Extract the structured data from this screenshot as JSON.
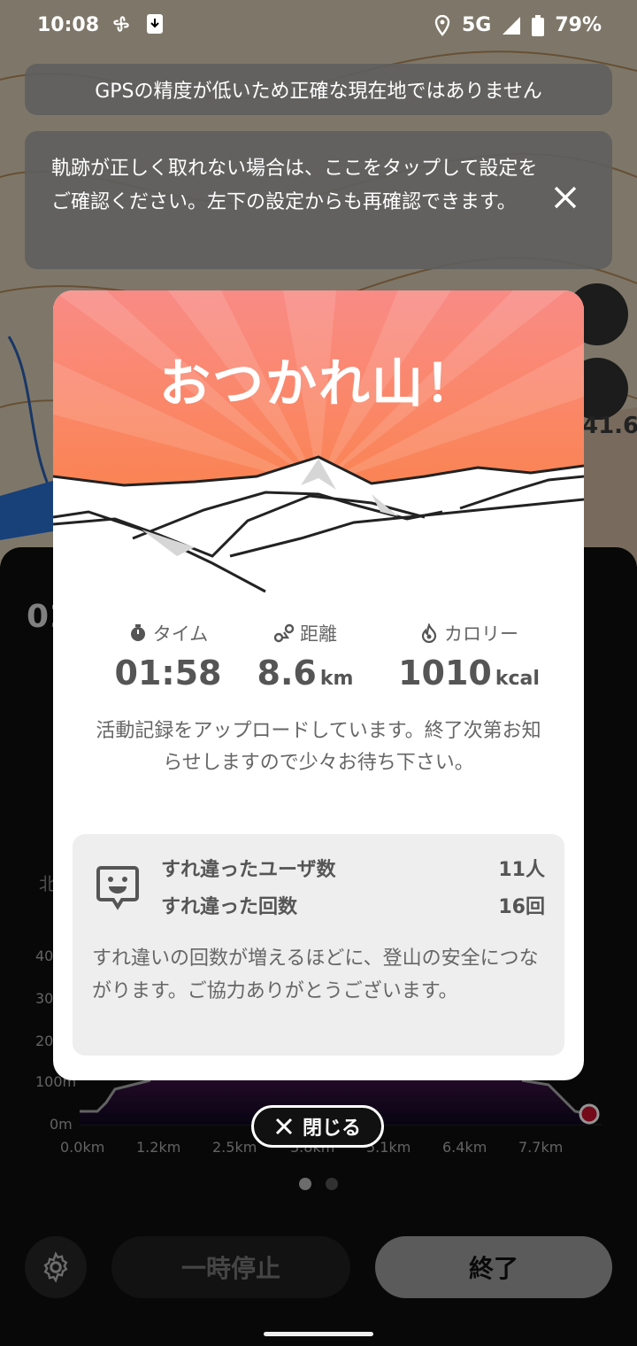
{
  "status_bar": {
    "time": "10:08",
    "network": "5G",
    "battery": "79%"
  },
  "banners": {
    "gps": "GPSの精度が低いため正確な現在地ではありません",
    "track": "軌跡が正しく取れない場合は、ここをタップして設定をご確認ください。左下の設定からも再確認できます。"
  },
  "side": {
    "number": "41.6"
  },
  "modal": {
    "title": "おつかれ山！",
    "stats": {
      "time_label": "タイム",
      "time_value": "01:58",
      "distance_label": "距離",
      "distance_value": "8.6",
      "distance_unit": "km",
      "calorie_label": "カロリー",
      "calorie_value": "1010",
      "calorie_unit": "kcal"
    },
    "upload_message": "活動記録をアップロードしています。終了次第お知らせしますので少々お待ち下さい。",
    "passing": {
      "users_label": "すれ違ったユーザ数",
      "users_value": "11人",
      "count_label": "すれ違った回数",
      "count_value": "16回",
      "note": "すれ違いの回数が増えるほどに、登山の安全につながります。ご協力ありがとうございます。"
    },
    "close_label": "閉じる"
  },
  "background_panel": {
    "time_partial": "01",
    "north_label": "北",
    "y_ticks": [
      "400",
      "300",
      "200",
      "100m",
      "0m"
    ],
    "x_ticks": [
      "0.0km",
      "1.2km",
      "2.5km",
      "3.8km",
      "5.1km",
      "6.4km",
      "7.7km"
    ],
    "pause_label": "一時停止",
    "end_label": "終了"
  },
  "colors": {
    "hero_top": "#f98b86",
    "hero_bottom": "#fb8038",
    "marker": "#c8102e"
  }
}
